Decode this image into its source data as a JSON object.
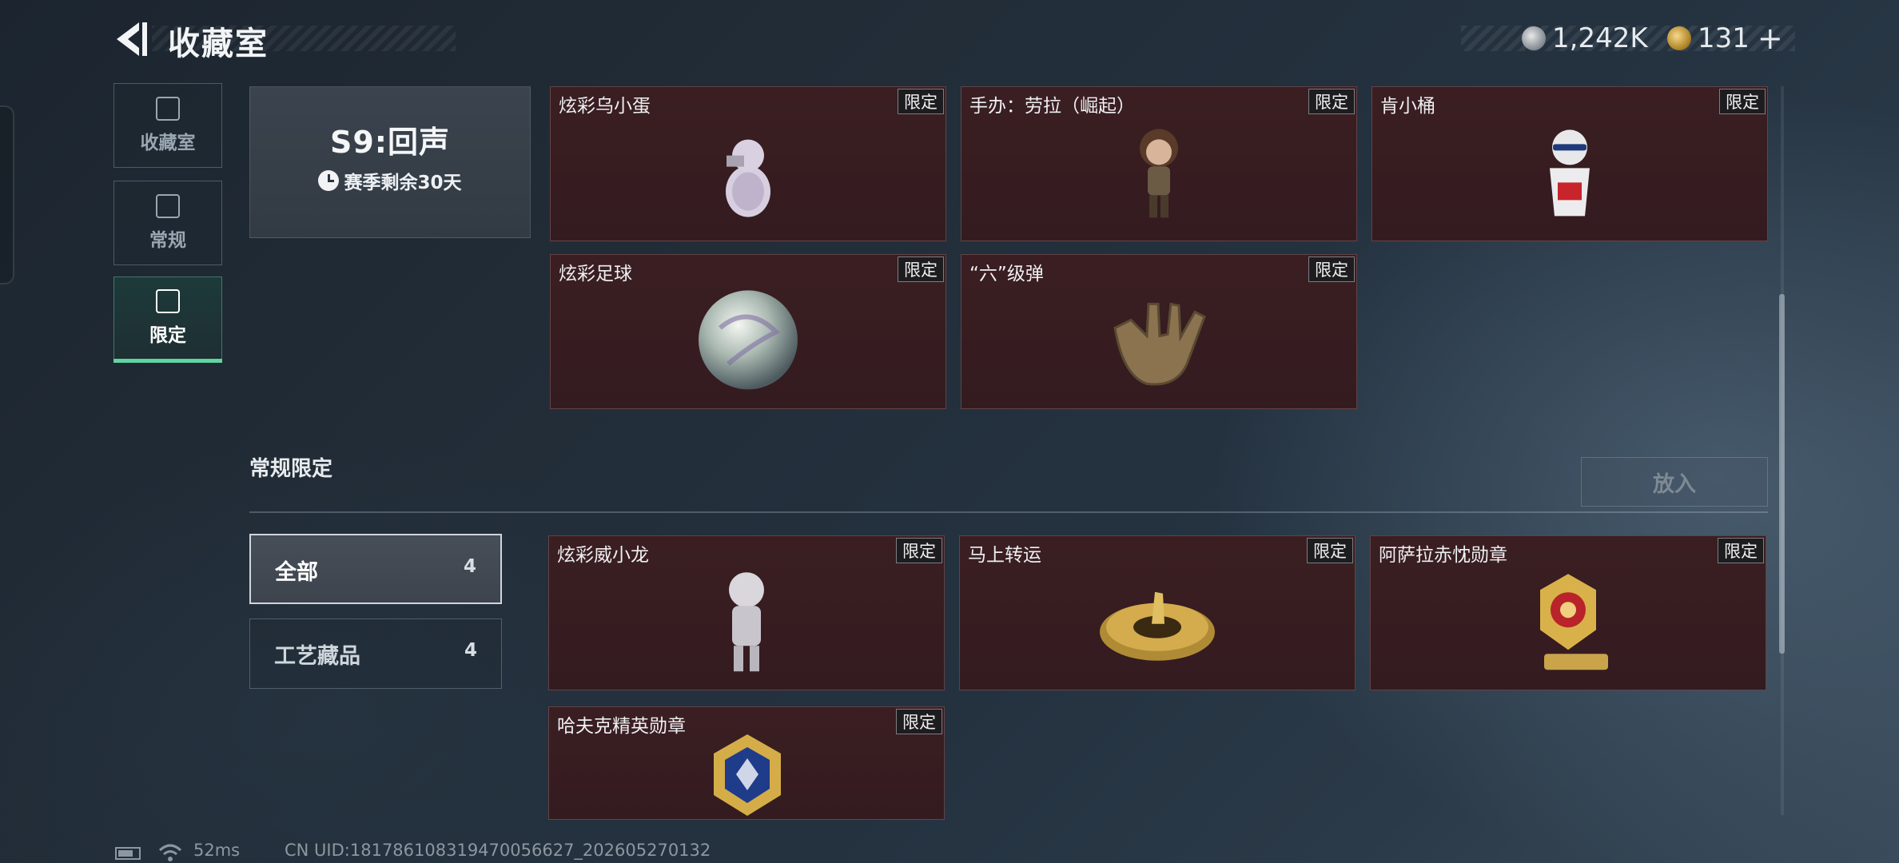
{
  "header": {
    "title": "收藏室"
  },
  "currency": {
    "silver_value": "1,242K",
    "gold_value": "131",
    "gold_plus": "+"
  },
  "sidebar": {
    "items": [
      {
        "label": "收藏室",
        "icon": "vault-icon"
      },
      {
        "label": "常规",
        "icon": "document-icon"
      },
      {
        "label": "限定",
        "icon": "limited-icon",
        "active": true
      }
    ]
  },
  "season": {
    "title": "S9:回声",
    "remaining": "赛季剩余30天"
  },
  "limited_items": [
    {
      "name": "炫彩乌小蛋",
      "tag": "限定"
    },
    {
      "name": "手办：劳拉（崛起）",
      "tag": "限定"
    },
    {
      "name": "肯小桶",
      "tag": "限定"
    },
    {
      "name": "炫彩足球",
      "tag": "限定"
    },
    {
      "name": "“六”级弹",
      "tag": "限定"
    }
  ],
  "regular_limited": {
    "title": "常规限定",
    "put_button": "放入",
    "filters": [
      {
        "label": "全部",
        "count": "4",
        "active": true
      },
      {
        "label": "工艺藏品",
        "count": "4"
      }
    ],
    "items": [
      {
        "name": "炫彩威小龙",
        "tag": "限定"
      },
      {
        "name": "马上转运",
        "tag": "限定"
      },
      {
        "name": "阿萨拉赤忱勋章",
        "tag": "限定"
      },
      {
        "name": "哈夫克精英勋章",
        "tag": "限定"
      }
    ]
  },
  "status_bar": {
    "ping": "52ms",
    "uid": "CN UID:18178610831947005662​7_202605270132"
  },
  "colors": {
    "accent": "#5fd5a1",
    "card_bg": "#3a1e22",
    "background": "#222d38"
  }
}
